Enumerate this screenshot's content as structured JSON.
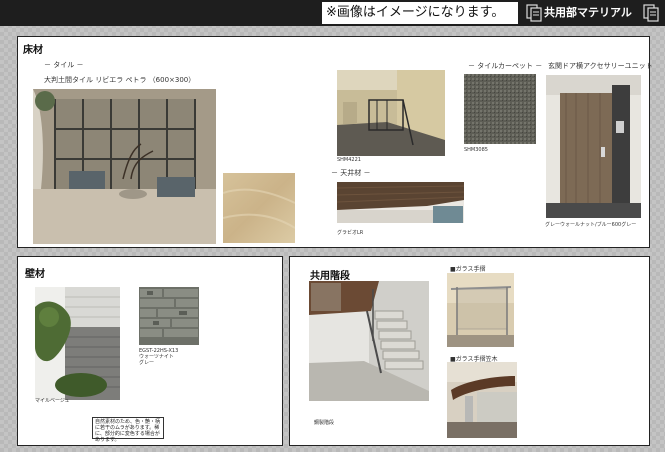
{
  "header": {
    "notice": "※画像はイメージになります。",
    "title": "共用部マテリアル"
  },
  "floor": {
    "title": "床材",
    "tile_label": "－ タイル －",
    "tile_name": "大判土間タイル リビエラ ペトラ （600×300）",
    "lobby_caption": "SHM4221",
    "tile_carpet_label": "－ タイルカーペット －",
    "carpet_caption": "SHM3085",
    "entrance_label": "玄関ドア横アクセサリーユニット",
    "entrance_caption": "グレーウォールナット/ブルー600グレー",
    "ceiling_label": "－ 天井材 －",
    "ceiling_caption": "グラビオLR"
  },
  "wall": {
    "title": "壁材",
    "wall_photo_caption": "マイルベージュ",
    "stone_caption_1": "EGST-22HS-X13",
    "stone_caption_2": "ウォーツナイト",
    "stone_caption_3": "グレー",
    "note": "自然素材のため、色・艶・柄に若干のムラがあります。稀に、部分的に変色する場合があります。"
  },
  "stairs": {
    "title": "共用階段",
    "stair_caption": "鋼製階段",
    "glass_rail_label": "■ガラス手摺",
    "glass_handrail_label": "■ガラス手摺笠木"
  }
}
